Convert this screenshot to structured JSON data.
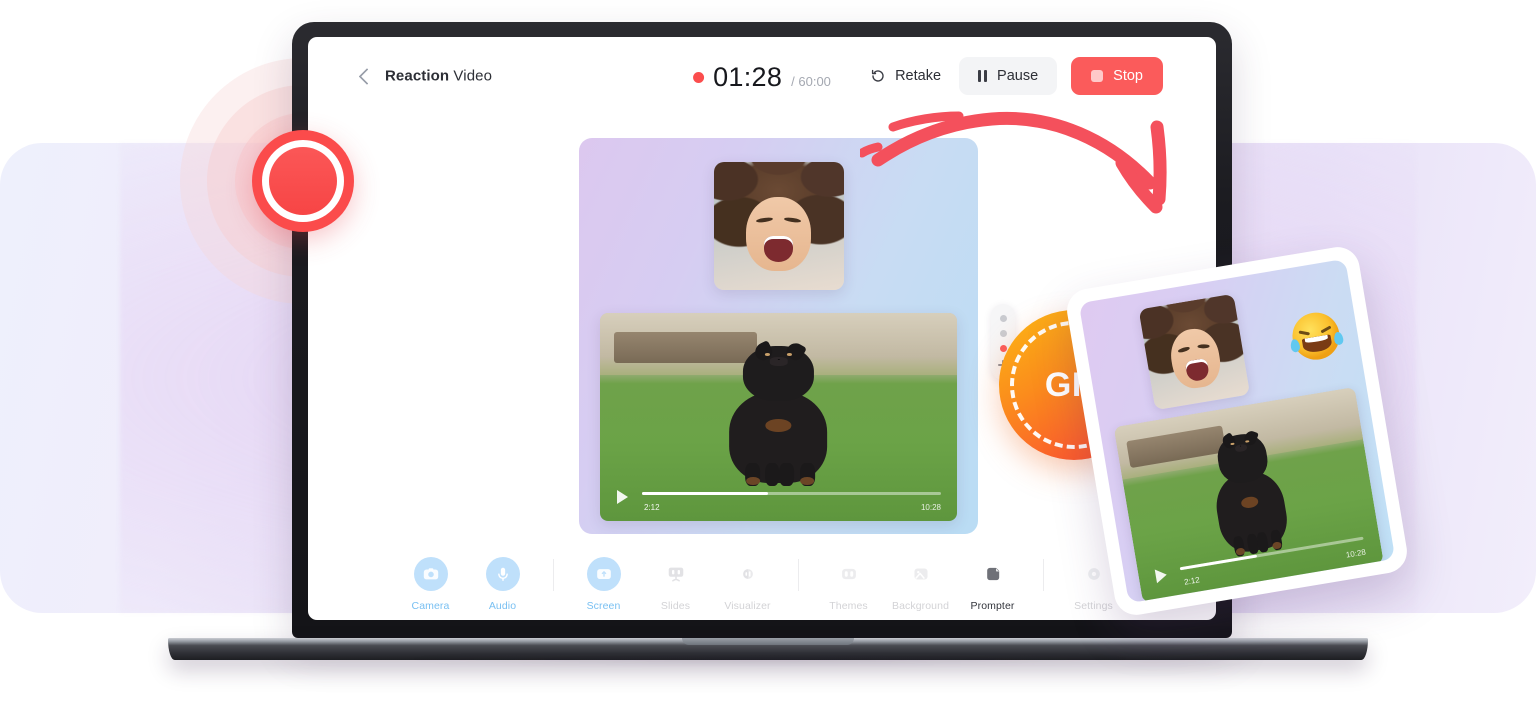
{
  "app": {
    "header": {
      "back_icon": "chevron-left-icon",
      "project_title_bold": "Reaction",
      "project_title_rest": " Video",
      "recording_dot": "record-dot-icon",
      "timer_current": "01:28",
      "timer_total": "/ 60:00",
      "retake_label": "Retake",
      "retake_icon": "rotate-ccw-icon",
      "pause_label": "Pause",
      "pause_icon": "pause-icon",
      "stop_label": "Stop",
      "stop_icon": "stop-square-icon"
    },
    "stage": {
      "camera_tile_name": "camera-preview-tile",
      "screen_tile_name": "screen-share-tile",
      "video": {
        "play_icon": "play-icon",
        "time_elapsed": "2:12",
        "time_total": "10:28",
        "progress_percent": 42
      },
      "dots_widget": {
        "name": "layout-selector",
        "dots": [
          "gray",
          "gray",
          "red"
        ],
        "add_icon": "plus-icon"
      }
    },
    "toolbar": [
      {
        "label": "Camera",
        "icon": "camera-icon",
        "state": "active"
      },
      {
        "label": "Audio",
        "icon": "microphone-icon",
        "state": "active"
      },
      {
        "label": "Screen",
        "icon": "screen-share-icon",
        "state": "active"
      },
      {
        "label": "Slides",
        "icon": "slides-icon",
        "state": "muted"
      },
      {
        "label": "Visualizer",
        "icon": "visualizer-icon",
        "state": "muted"
      },
      {
        "label": "Themes",
        "icon": "themes-icon",
        "state": "muted"
      },
      {
        "label": "Background",
        "icon": "background-icon",
        "state": "muted"
      },
      {
        "label": "Prompter",
        "icon": "prompter-icon",
        "state": "dark"
      },
      {
        "label": "Settings",
        "icon": "settings-icon",
        "state": "muted"
      }
    ]
  },
  "decor": {
    "record_button": {
      "name": "record-button",
      "icon": "record-circle-icon"
    },
    "arrow": {
      "name": "curved-arrow-annotation",
      "color": "#f4505c"
    },
    "gif_badge": {
      "label": "GIF",
      "color_from": "#fcb814",
      "color_to": "#f9492f"
    },
    "float_card": {
      "name": "gif-output-preview-card",
      "emoji": "rofl-emoji",
      "video": {
        "time_elapsed": "2:12",
        "time_total": "10:28",
        "progress_percent": 42
      }
    }
  },
  "colors": {
    "accent_red": "#fb5b5b",
    "accent_blue": "#79c0f2",
    "panel_lavender": "#e6ddf4",
    "muted_gray": "#d3d3d6"
  }
}
